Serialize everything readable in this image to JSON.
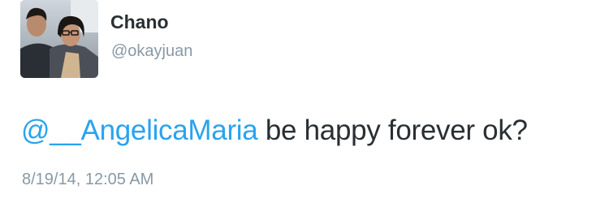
{
  "tweet": {
    "author": {
      "display_name": "Chano",
      "handle": "@okayjuan",
      "avatar_icon": "profile-photo"
    },
    "mention": "@__AngelicaMaria",
    "text": " be happy forever ok?",
    "timestamp": "8/19/14, 12:05 AM"
  },
  "colors": {
    "mention": "#2aa3ef",
    "text": "#292f33",
    "secondary": "#8899a6"
  }
}
